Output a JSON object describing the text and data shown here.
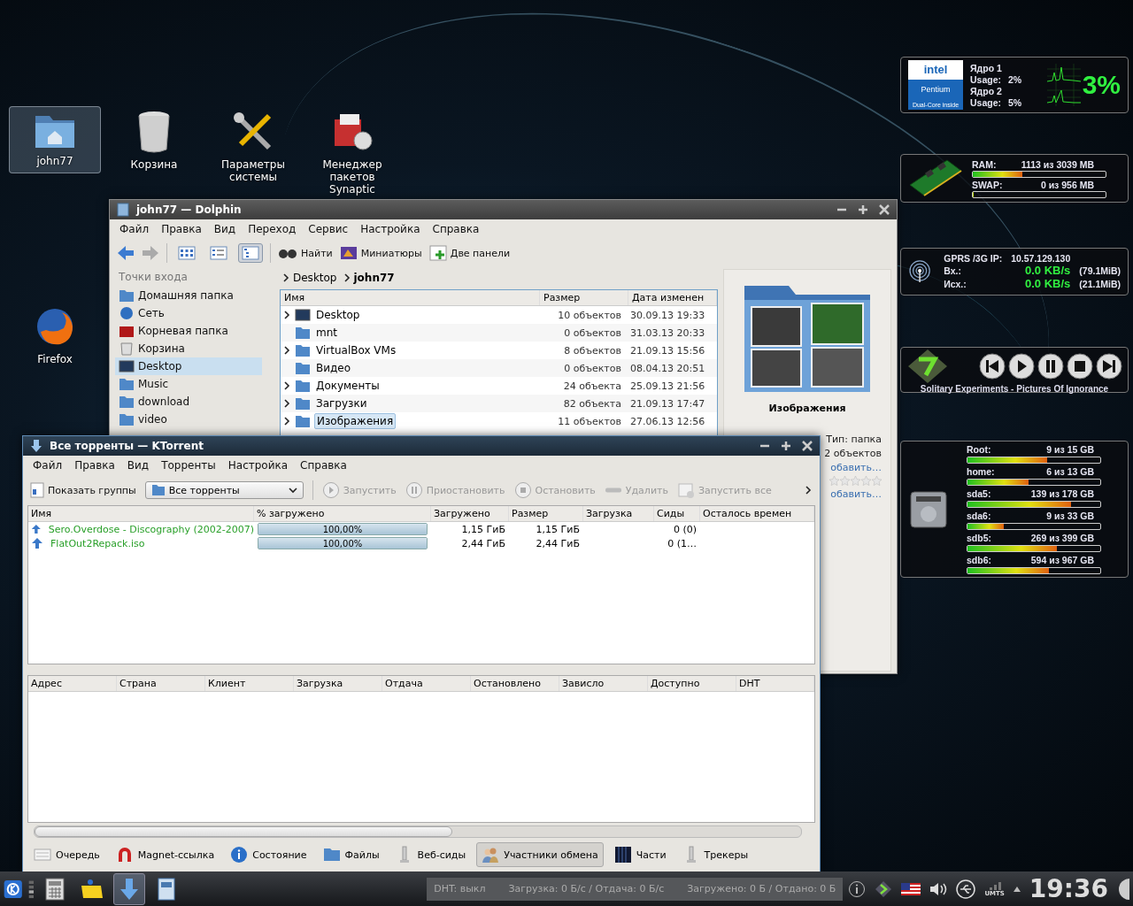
{
  "desktop_icons": [
    {
      "label": "john77",
      "kind": "home",
      "selected": true
    },
    {
      "label": "Корзина",
      "kind": "trash",
      "selected": false
    },
    {
      "label": "Параметры системы",
      "kind": "tools",
      "selected": false
    },
    {
      "label": "Менеджер пакетов Synaptic",
      "kind": "package",
      "selected": false
    },
    {
      "label": "Firefox",
      "kind": "firefox",
      "selected": false
    }
  ],
  "dolphin": {
    "title": "john77 — Dolphin",
    "menu": [
      "Файл",
      "Правка",
      "Вид",
      "Переход",
      "Сервис",
      "Настройка",
      "Справка"
    ],
    "view_modes": [
      {
        "kind": "icons",
        "selected": false
      },
      {
        "kind": "compact",
        "selected": false
      },
      {
        "kind": "details",
        "selected": true
      }
    ],
    "toolbar": [
      {
        "label": "Найти",
        "kind": "find"
      },
      {
        "label": "Миниатюры",
        "kind": "preview"
      },
      {
        "label": "Две панели",
        "kind": "split"
      }
    ],
    "places": {
      "title": "Точки входа",
      "items": [
        {
          "label": "Домашняя папка",
          "kind": "home",
          "selected": false
        },
        {
          "label": "Сеть",
          "kind": "network",
          "selected": false
        },
        {
          "label": "Корневая папка",
          "kind": "root",
          "selected": false
        },
        {
          "label": "Корзина",
          "kind": "trash",
          "selected": false
        },
        {
          "label": "Desktop",
          "kind": "desktop",
          "selected": true
        },
        {
          "label": "Music",
          "kind": "folder",
          "selected": false
        },
        {
          "label": "download",
          "kind": "folder",
          "selected": false
        },
        {
          "label": "video",
          "kind": "folder",
          "selected": false
        }
      ]
    },
    "breadcrumb": [
      "Desktop",
      "john77"
    ],
    "columns": [
      "Имя",
      "Размер",
      "Дата изменен"
    ],
    "files": [
      {
        "name": "Desktop",
        "size": "10 объектов",
        "date": "30.09.13 19:33",
        "expandable": true,
        "kind": "desktop",
        "selected": false
      },
      {
        "name": "mnt",
        "size": "0 объектов",
        "date": "31.03.13 20:33",
        "expandable": false,
        "kind": "folder",
        "selected": false
      },
      {
        "name": "VirtualBox VMs",
        "size": "8 объектов",
        "date": "21.09.13 15:56",
        "expandable": true,
        "kind": "folder",
        "selected": false
      },
      {
        "name": "Видео",
        "size": "0 объектов",
        "date": "08.04.13 20:51",
        "expandable": false,
        "kind": "folder",
        "selected": false
      },
      {
        "name": "Документы",
        "size": "24 объекта",
        "date": "25.09.13 21:56",
        "expandable": true,
        "kind": "folder",
        "selected": false
      },
      {
        "name": "Загрузки",
        "size": "82 объекта",
        "date": "21.09.13 17:47",
        "expandable": true,
        "kind": "folder",
        "selected": false
      },
      {
        "name": "Изображения",
        "size": "11 объектов",
        "date": "27.06.13 12:56",
        "expandable": true,
        "kind": "folder",
        "selected": true
      }
    ],
    "info": {
      "title": "Изображения",
      "items": [
        {
          "kind": "text",
          "text": "Тип: папка"
        },
        {
          "kind": "text",
          "text": "2 объектов"
        },
        {
          "kind": "link",
          "text": "обавить…"
        },
        {
          "kind": "stars",
          "stars": 0
        },
        {
          "kind": "link",
          "text": "обавить…"
        }
      ]
    }
  },
  "ktorrent": {
    "title": "Все торренты — KTorrent",
    "menu": [
      "Файл",
      "Правка",
      "Вид",
      "Торренты",
      "Настройка",
      "Справка"
    ],
    "show_groups": "Показать группы",
    "group": "Все торренты",
    "actions": [
      {
        "label": "Запустить",
        "kind": "play",
        "disabled": true
      },
      {
        "label": "Приостановить",
        "kind": "pause",
        "disabled": true
      },
      {
        "label": "Остановить",
        "kind": "stop",
        "disabled": true
      },
      {
        "label": "Удалить",
        "kind": "remove",
        "disabled": true
      },
      {
        "label": "Запустить все",
        "kind": "start-all",
        "disabled": true
      }
    ],
    "columns": [
      "Имя",
      "% загружено",
      "Загружено",
      "Размер",
      "Загрузка",
      "Сиды",
      "Осталось времен"
    ],
    "torrents": [
      {
        "name": "Sero.Overdose - Discography (2002-2007)",
        "level": 1,
        "percent": "100,00%",
        "downloaded": "1,15 ГиБ",
        "size": "1,15 ГиБ",
        "seeds": "0 (0)"
      },
      {
        "name": "FlatOut2Repack.iso",
        "level": 1,
        "percent": "100,00%",
        "downloaded": "2,44 ГиБ",
        "size": "2,44 ГиБ",
        "seeds": "0 (1…"
      }
    ],
    "peer_columns": [
      "Адрес",
      "Страна",
      "Клиент",
      "Загрузка",
      "Отдача",
      "Остановлено",
      "Зависло",
      "Доступно",
      "DHT"
    ],
    "tabs": [
      {
        "label": "Очередь",
        "kind": "queue",
        "selected": false
      },
      {
        "label": "Magnet-ссылка",
        "kind": "magnet",
        "selected": false
      },
      {
        "label": "Состояние",
        "kind": "info",
        "selected": false
      },
      {
        "label": "Файлы",
        "kind": "folder",
        "selected": false
      },
      {
        "label": "Веб-сиды",
        "kind": "pin",
        "selected": false
      },
      {
        "label": "Участники обмена",
        "kind": "peers",
        "selected": true
      },
      {
        "label": "Части",
        "kind": "chunks",
        "selected": false
      },
      {
        "label": "Трекеры",
        "kind": "pin",
        "selected": false
      }
    ],
    "status": [
      "DHT: выкл",
      "Загрузка: 0 Б/с / Отдача: 0 Б/с",
      "Загружено: 0 Б / Отдано: 0 Б"
    ]
  },
  "cpu": {
    "logo": [
      "intel",
      "Pentium",
      "Dual-Core inside"
    ],
    "cores": [
      {
        "label": "Ядро 1",
        "usage_label": "Usage:",
        "usage": "2%"
      },
      {
        "label": "Ядро 2",
        "usage_label": "Usage:",
        "usage": "5%"
      }
    ],
    "total": "3%"
  },
  "memory": [
    {
      "label": "RAM:",
      "value": "1113 из 3039 MB",
      "level": 0.37
    },
    {
      "label": "SWAP:",
      "value": "0 из 956 MB",
      "level": 0
    }
  ],
  "network": {
    "ip_label": "GPRS /3G IP:",
    "ip": "10.57.129.130",
    "rows": [
      {
        "label": "Вх.:",
        "speed": "0.0 KB/s",
        "total": "(79.1MiB)"
      },
      {
        "label": "Исх.:",
        "speed": "0.0 KB/s",
        "total": "(21.1MiB)"
      }
    ]
  },
  "player": {
    "track": "Solitary Experiments - Pictures Of Ignorance",
    "controls": [
      {
        "kind": "prev"
      },
      {
        "kind": "play"
      },
      {
        "kind": "pause"
      },
      {
        "kind": "stop"
      },
      {
        "kind": "next"
      }
    ]
  },
  "disks": [
    {
      "label": "Root:",
      "value": "9 из 15 GB",
      "level": 0.6
    },
    {
      "label": "home:",
      "value": "6 из 13 GB",
      "level": 0.46
    },
    {
      "label": "sda5:",
      "value": "139 из 178 GB",
      "level": 0.78
    },
    {
      "label": "sda6:",
      "value": "9 из 33 GB",
      "level": 0.27
    },
    {
      "label": "sdb5:",
      "value": "269 из 399 GB",
      "level": 0.67
    },
    {
      "label": "sdb6:",
      "value": "594 из 967 GB",
      "level": 0.61
    }
  ],
  "taskbar": {
    "launchers": [
      {
        "kind": "calculator",
        "selected": false
      },
      {
        "kind": "notes",
        "selected": false
      },
      {
        "kind": "ktorrent",
        "selected": true
      },
      {
        "kind": "dolphin",
        "selected": false
      }
    ],
    "network_label": "UMTS",
    "clock": "19:36"
  }
}
